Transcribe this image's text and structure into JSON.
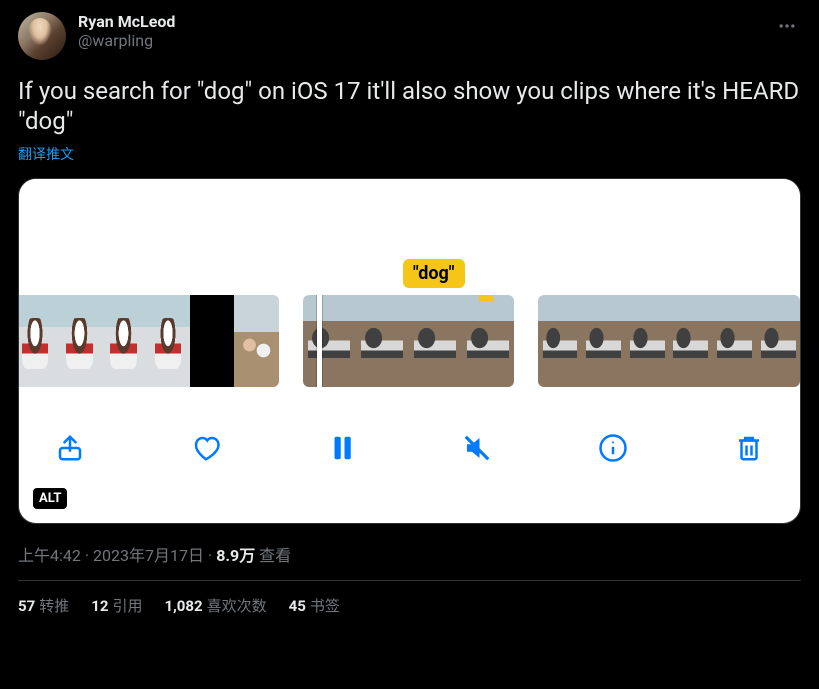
{
  "author": {
    "display_name": "Ryan McLeod",
    "handle": "@warpling"
  },
  "tweet_text": "If you search for \"dog\" on iOS 17 it'll also show you clips where it's HEARD \"dog\"",
  "translate_label": "翻译推文",
  "media": {
    "tag_text": "\"dog\"",
    "alt_badge": "ALT"
  },
  "meta": {
    "time": "上午4:42",
    "date": "2023年7月17日",
    "views_count": "8.9万",
    "views_label": "查看"
  },
  "stats": {
    "retweets_count": "57",
    "retweets_label": "转推",
    "quotes_count": "12",
    "quotes_label": "引用",
    "likes_count": "1,082",
    "likes_label": "喜欢次数",
    "bookmarks_count": "45",
    "bookmarks_label": "书签"
  }
}
